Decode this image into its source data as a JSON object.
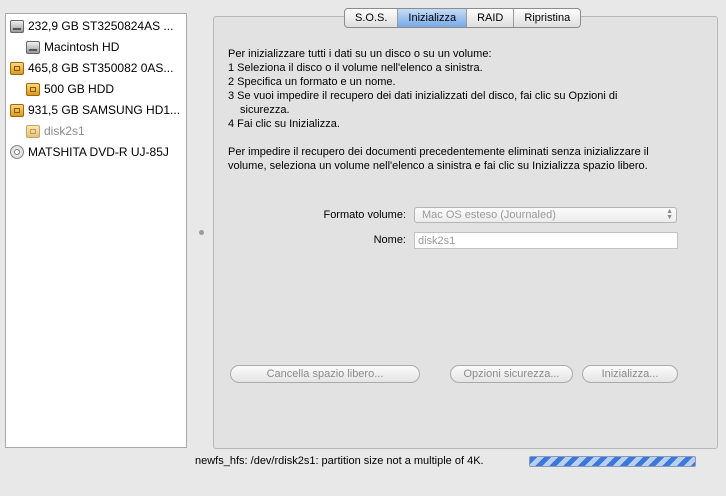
{
  "sidebar": {
    "items": [
      {
        "label": "232,9 GB ST3250824AS ...",
        "icon": "hard-disk-icon"
      },
      {
        "label": "Macintosh HD",
        "icon": "hard-disk-icon"
      },
      {
        "label": "465,8 GB ST350082 0AS...",
        "icon": "external-disk-icon"
      },
      {
        "label": "500 GB HDD",
        "icon": "external-disk-icon"
      },
      {
        "label": "931,5 GB SAMSUNG HD1...",
        "icon": "external-disk-icon"
      },
      {
        "label": "disk2s1",
        "icon": "external-disk-icon"
      },
      {
        "label": "MATSHITA DVD-R UJ-85J",
        "icon": "dvd-drive-icon"
      }
    ]
  },
  "tabs": [
    {
      "label": "S.O.S."
    },
    {
      "label": "Inizializza"
    },
    {
      "label": "RAID"
    },
    {
      "label": "Ripristina"
    }
  ],
  "active_tab": "Inizializza",
  "instructions": {
    "intro": "Per inizializzare tutti i dati su un disco o su un volume:",
    "steps": [
      "1 Seleziona il disco o il volume nell'elenco a sinistra.",
      "2 Specifica un formato e un nome.",
      "3 Se vuoi impedire il recupero dei dati inizializzati del disco, fai clic su Opzioni di",
      "sicurezza.",
      "4 Fai clic su Inizializza."
    ],
    "secure_line1": "Per impedire il recupero dei documenti precedentemente eliminati senza inizializzare il",
    "secure_line2": "volume, seleziona un volume nell'elenco a sinistra e fai clic su Inizializza spazio libero."
  },
  "form": {
    "format_label": "Formato volume:",
    "format_value": "Mac OS esteso (Journaled)",
    "name_label": "Nome:",
    "name_value": "disk2s1"
  },
  "buttons": {
    "erase_free_space": "Cancella spazio libero...",
    "security_options": "Opzioni sicurezza...",
    "erase": "Inizializza..."
  },
  "status": {
    "message": "newfs_hfs: /dev/rdisk2s1: partition size not a multiple of 4K."
  },
  "colors": {
    "active_tab": "#77a8e8",
    "progress_stripe": "#3c78d8",
    "disabled_text": "#8a8a8a"
  }
}
